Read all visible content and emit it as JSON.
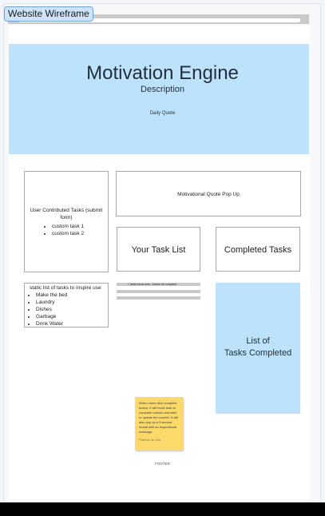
{
  "wireframe_label": "Website Wireframe",
  "hero": {
    "title": "Motivation Engine",
    "description": "Description",
    "daily_quote": "Daily Quote"
  },
  "user_tasks": {
    "heading": "User Contributed Tasks (submit form)",
    "items": [
      "custom task 1",
      "custom task 2"
    ]
  },
  "quote_popup": "Motivational Quote Pop Up",
  "your_task_list": "Your Task List",
  "completed_tasks": "Completed Tasks",
  "static_list": {
    "heading": "static list of tasks to inspire use",
    "items": [
      "Make the bed",
      "Laundry",
      "Dishes",
      "Garbage",
      "Drink Water"
    ]
  },
  "task_line": "• Tasks show here - button for complete",
  "list_completed": [
    "List of",
    "Tasks Completed"
  ],
  "sticky_note": {
    "text": "When users click complete button, it will move task to complete column and start or update the counter. It will also pop up a 5 second modal with an inspirational message.",
    "author": "Patricia de Vita"
  },
  "footer": "FOOTER",
  "colors": {
    "hero_bg": "#bde2fb",
    "sticky_bg": "#fbd96b",
    "label_bg": "#cfe3fb"
  }
}
